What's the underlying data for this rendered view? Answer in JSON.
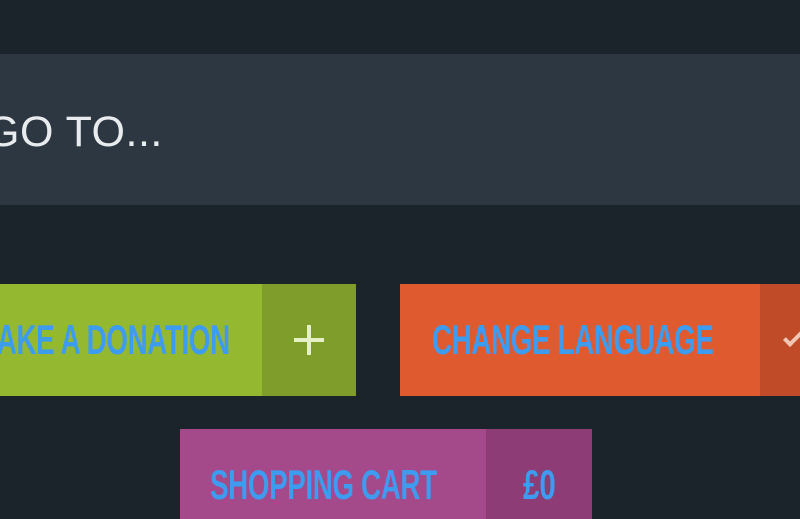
{
  "goto": {
    "text": "GO TO..."
  },
  "buttons": {
    "donate": {
      "label": "MAKE A DONATION",
      "icon": "plus-icon",
      "color": "#95b831",
      "accent": "#7f9d2a"
    },
    "language": {
      "label": "CHANGE LANGUAGE",
      "icon": "chevron-down-icon",
      "color": "#df5a2f",
      "accent": "#bf4b28"
    },
    "cart": {
      "label": "SHOPPING CART",
      "total": "£0",
      "color": "#a44a8b",
      "accent": "#8e3c75"
    }
  },
  "colors": {
    "background": "#1b232b",
    "bar": "#2d3741",
    "label_text": "#3d9bf0"
  }
}
